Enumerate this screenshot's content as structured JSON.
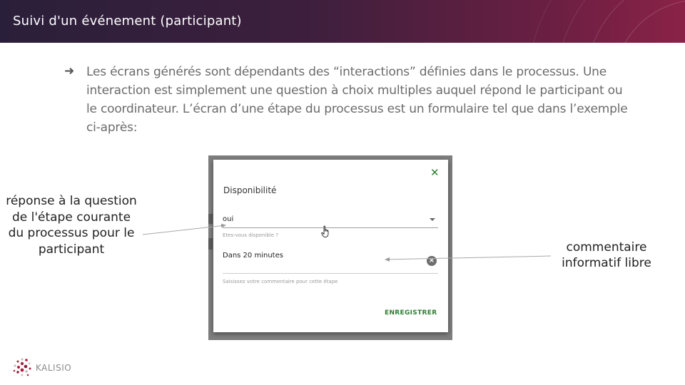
{
  "header": {
    "title": "Suivi d'un événement (participant)"
  },
  "bullet": {
    "text": "Les écrans générés sont dépendants des “interactions” définies dans le processus. Une interaction est simplement une question à choix multiples auquel répond le participant ou le coordinateur. L’écran d’une étape du processus est un formulaire tel que dans l’exemple ci-après:"
  },
  "dialog": {
    "title": "Disponibilité",
    "close_icon": "close-icon",
    "select_value": "oui",
    "select_hint": "Etes-vous disponible ?",
    "comment_value": "Dans 20 minutes",
    "comment_hint": "Saisissez votre commentaire pour cette étape",
    "save_label": "ENREGISTRER",
    "accent_color": "#2e7d32"
  },
  "annotations": {
    "left": "réponse à la question de l'étape courante du processus pour le participant",
    "right": "commentaire informatif libre"
  },
  "logo": {
    "text": "KALISIO"
  },
  "colors": {
    "header_start": "#2a1f3a",
    "header_end": "#8a2247",
    "logo_accent": "#b0203f"
  }
}
